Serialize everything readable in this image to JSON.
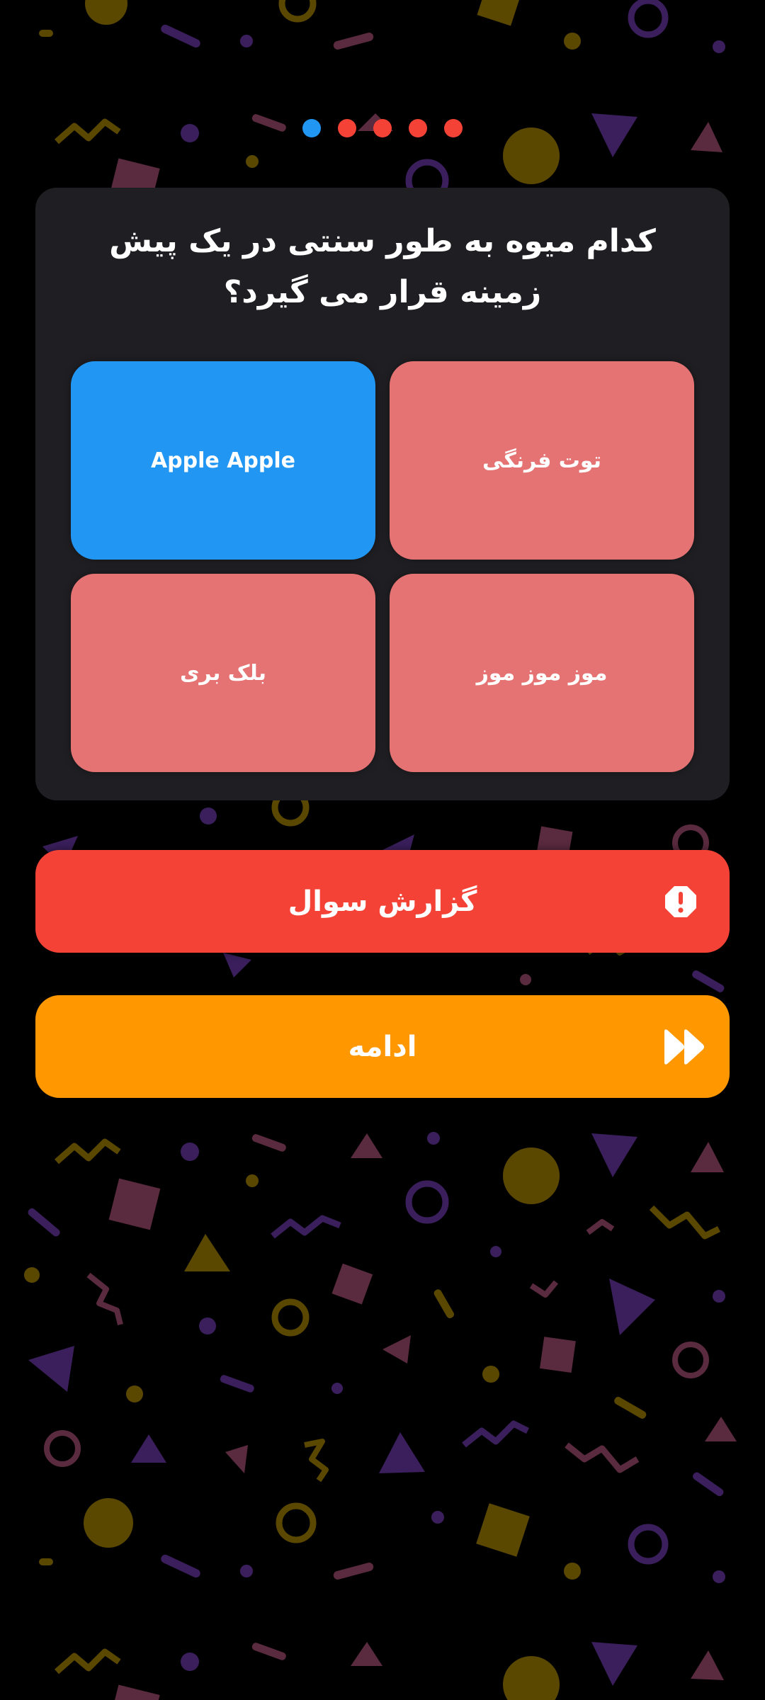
{
  "quiz": {
    "progress": [
      {
        "state": "current",
        "color": "#2196f3"
      },
      {
        "state": "wrong",
        "color": "#f44336"
      },
      {
        "state": "wrong",
        "color": "#f44336"
      },
      {
        "state": "wrong",
        "color": "#f44336"
      },
      {
        "state": "wrong",
        "color": "#f44336"
      }
    ],
    "question": "کدام میوه به طور سنتی در یک پیش زمینه قرار می گیرد؟",
    "answers": [
      {
        "label": "توت فرنگی",
        "color": "#e57373",
        "state": "wrong"
      },
      {
        "label": "Apple Apple",
        "color": "#2196f3",
        "state": "correct"
      },
      {
        "label": "موز موز موز",
        "color": "#e57373",
        "state": "wrong"
      },
      {
        "label": "بلک بری",
        "color": "#e57373",
        "state": "wrong"
      }
    ]
  },
  "actions": {
    "report": {
      "label": "گزارش سوال",
      "color": "#f44336",
      "icon": "alert-octagon-icon"
    },
    "continue": {
      "label": "ادامه",
      "color": "#ff9800",
      "icon": "fast-forward-icon"
    }
  },
  "colors": {
    "background": "#000000",
    "card": "#1f1e22",
    "pattern_yellow": "#5a4700",
    "pattern_purple": "#3a1f5c",
    "pattern_pink": "#5a2a3e"
  }
}
